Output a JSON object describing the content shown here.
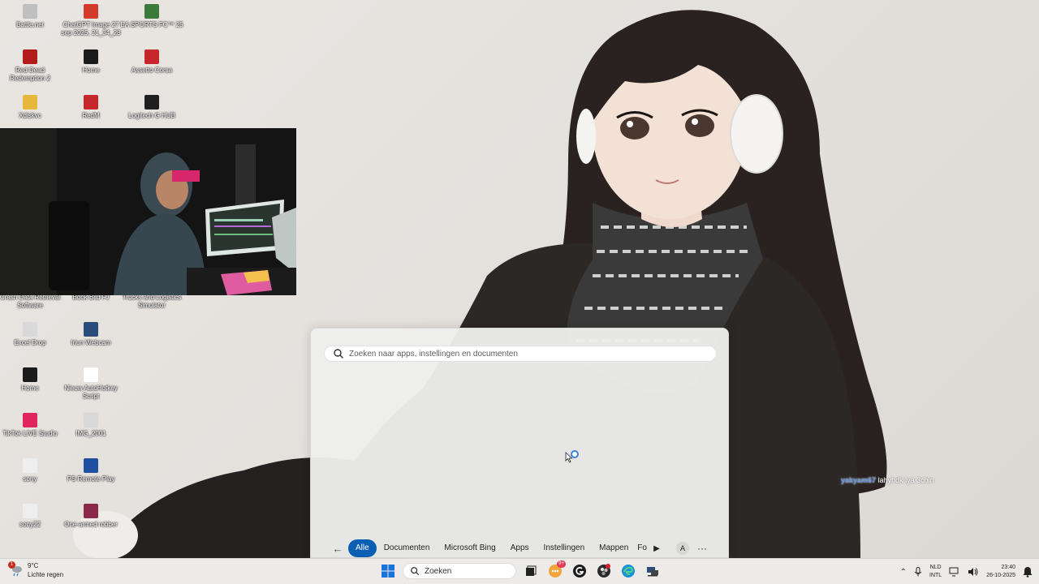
{
  "desktop": {
    "icons": [
      {
        "label": "Battle.net",
        "color": "#bfbfbf"
      },
      {
        "label": "ChatGPT Image 27 sep 2025, 21_34_28",
        "color": "#d33a2c"
      },
      {
        "label": "EA SPORTS FC™ 25",
        "color": "#3c7a3c"
      },
      {
        "label": "Red Dead Redemption 2",
        "color": "#b31b1b"
      },
      {
        "label": "Home",
        "color": "#1b1b1b"
      },
      {
        "label": "Assetto Corsa",
        "color": "#c7262b"
      },
      {
        "label": "Xdiskvc",
        "color": "#e5b73b"
      },
      {
        "label": "RedM",
        "color": "#c7262b"
      },
      {
        "label": "Logitech G HUB",
        "color": "#1f1f1f"
      },
      {
        "label": "Crash Data Retrieval Software",
        "color": "#6b6b6b"
      },
      {
        "label": "Book Bild FJ",
        "color": "#6b6b6b"
      },
      {
        "label": "Trucks and Logistics Simulator",
        "color": "#6b6b6b"
      },
      {
        "label": "Excel Drop",
        "color": "#d9d9d9"
      },
      {
        "label": "Iriun Webcam",
        "color": "#2a4c7a"
      },
      {
        "label": "Home",
        "color": "#1b1b1b"
      },
      {
        "label": "Nieuw AutoHotkey Script",
        "color": "#ffffff"
      },
      {
        "label": "TikTok LIVE Studio",
        "color": "#e0245e"
      },
      {
        "label": "IMG_2001",
        "color": "#d9d9d9"
      },
      {
        "label": "sony",
        "color": "#eeeeee"
      },
      {
        "label": "PS Remote Play",
        "color": "#1f4fa0"
      },
      {
        "label": "sony22",
        "color": "#eeeeee"
      },
      {
        "label": "One-armed robber",
        "color": "#8a2a4a"
      }
    ]
  },
  "search_panel": {
    "placeholder": "Zoeken naar apps, instellingen en documenten",
    "filters": [
      "Alle",
      "Documenten",
      "Microsoft Bing",
      "Apps",
      "Instellingen",
      "Mappen",
      "Fo"
    ],
    "active_filter": "Alle",
    "avatar_letter": "A",
    "more": "···"
  },
  "chat": {
    "user": "yakyam67",
    "message": "lahyhdk lya 3chin"
  },
  "taskbar": {
    "weather_temp": "9°C",
    "weather_desc": "Lichte regen",
    "weather_badge": "1",
    "search_label": "Zoeken",
    "app_badge": "9+",
    "lang_code": "NLD",
    "lang_layout": "INTL",
    "time": "23:40",
    "date": "26-10-2025"
  },
  "colors": {
    "accent": "#0b5fb2",
    "taskbar_bg": "#ecebe8"
  }
}
